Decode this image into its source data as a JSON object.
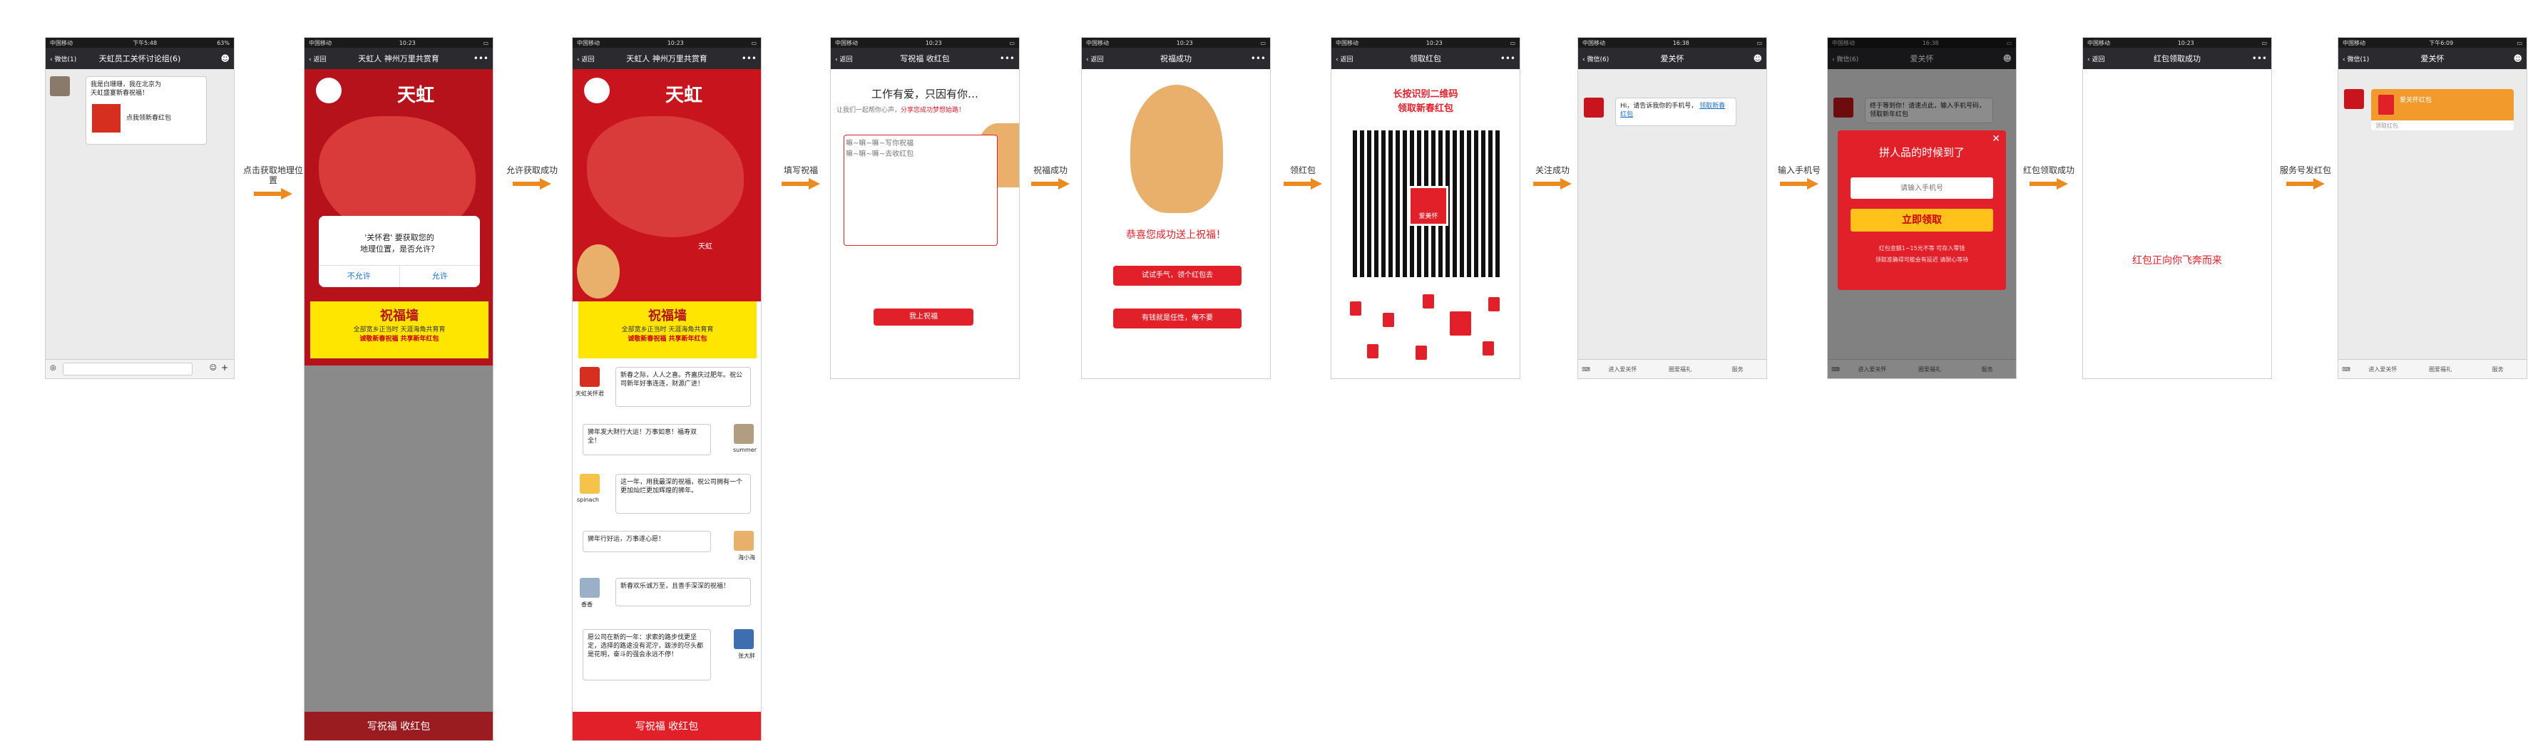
{
  "status": {
    "carrier1": "微信(1)",
    "time1": "下午5:48",
    "battery1": "63%",
    "carrier": "中国移动",
    "time": "10:23",
    "time2": "16:38",
    "time3": "下午6:09"
  },
  "screen1": {
    "back": "微信(1)",
    "title": "天虹员工关怀讨论组(6)",
    "msg_line1": "我是白珊珊，我在北京为",
    "msg_line2": "天虹盛宴新春祝福！",
    "link_text": "点我领新春红包"
  },
  "arrow1": "点击获取地理位置",
  "screen2": {
    "back": "返回",
    "title": "天虹人 神州万里共赏育",
    "brand": "天虹",
    "dialog_text1": "'关怀君' 要获取您的",
    "dialog_text2": "地理位置，是否允许？",
    "deny": "不允许",
    "allow": "允许",
    "wall_title": "祝福墙",
    "wall_sub1": "全部宽乡正当时  天涯海角共育育",
    "wall_sub2": "诚敬新春祝福   共享新年红包",
    "footer": "写祝福 收红包"
  },
  "arrow2": "允许获取成功",
  "screen3": {
    "back": "返回",
    "title": "天虹人 神州万里共赏育",
    "brand": "天虹",
    "map_city": "天虹",
    "wall_title": "祝福墙",
    "wall_sub1": "全部宽乡正当时  天涯海角共育育",
    "wall_sub2": "诚敬新春祝福   共享新年红包",
    "msgs": [
      {
        "name": "天虹关怀君",
        "text": "新春之际，人人之喜。齐嘉庆过肥年。祝公司新年好事连连，财源广进！"
      },
      {
        "name": "summer",
        "text": "狮年发大财行大运！万事如意！福寿双全！"
      },
      {
        "name": "spinach",
        "text": "这一年，用我最深的祝福，祝公司拥有一个更加灿烂更加辉煌的狮年。"
      },
      {
        "name": "海小海",
        "text": "狮年行好运，万事遂心愿！"
      },
      {
        "name": "香香",
        "text": "新春欢乐诚万至，且善手深深的祝福！"
      },
      {
        "name": "张大胖",
        "text": "愿公司在新的一年：求索的路步伐更坚定，选择的路途没有泥泞，跋涉的尽头都是花明，奋斗的强会永远不停！"
      }
    ],
    "footer": "写祝福 收红包"
  },
  "arrow3": "填写祝福",
  "screen4": {
    "back": "返回",
    "title": "写祝福 收红包",
    "heading": "工作有爱，只因有你…",
    "sub_prefix": "让我们一起帮你心声，",
    "sub_highlight": "分享您成功梦想始路！",
    "placeholder": "嘛~嘛~嘛~写你祝福\n嘛~嘛~嘛~去收红包",
    "submit": "我上祝福"
  },
  "arrow4": "祝福成功",
  "screen5": {
    "back": "返回",
    "title": "祝福成功",
    "congrats": "恭喜您成功送上祝福！",
    "btn1": "试试手气，领个红包去",
    "btn2": "有钱就是任性，俺不要"
  },
  "arrow5": "领红包",
  "screen6": {
    "back": "返回",
    "title": "领取红包",
    "line1": "长按识别二维码",
    "line2": "领取新春红包",
    "qr_label": "爱美怀"
  },
  "arrow6": "关注成功",
  "screen7": {
    "back": "微信(6)",
    "title": "爱关怀",
    "msg": "Hi，请告诉我你的手机号，",
    "link": "领取新春红包",
    "menu": [
      "进入爱关怀",
      "圈爱福礼",
      "服务"
    ]
  },
  "arrow7": "输入手机号",
  "screen8": {
    "back": "微信(6)",
    "title": "爱关怀",
    "msg": "终于等到你！请速点此，输入手机号码，领取新年红包",
    "popup_title": "拼人品的时候到了",
    "input_placeholder": "请输入手机号",
    "claim": "立即领取",
    "note1": "红包金额1~15元不等 可存入零钱",
    "note2": "领取准确得可能会有延迟 请耐心等待",
    "menu": [
      "进入爱关怀",
      "圈爱福礼",
      "服务"
    ]
  },
  "arrow8": "红包领取成功",
  "screen9": {
    "back": "返回",
    "title": "红包领取成功",
    "message": "红包正向你飞奔而来"
  },
  "arrow9": "服务号发红包",
  "screen10": {
    "back": "微信(1)",
    "title": "爱关怀",
    "card_title": "爱关怀红包",
    "card_sub": "领取红包",
    "menu": [
      "进入爱关怀",
      "圈爱福礼",
      "服务"
    ]
  },
  "colors": {
    "arrow": "#ec8a1f",
    "red": "#e2202a",
    "dark_red": "#b5121b",
    "nav": "#2b2b2f",
    "yellow": "#ffe600"
  }
}
